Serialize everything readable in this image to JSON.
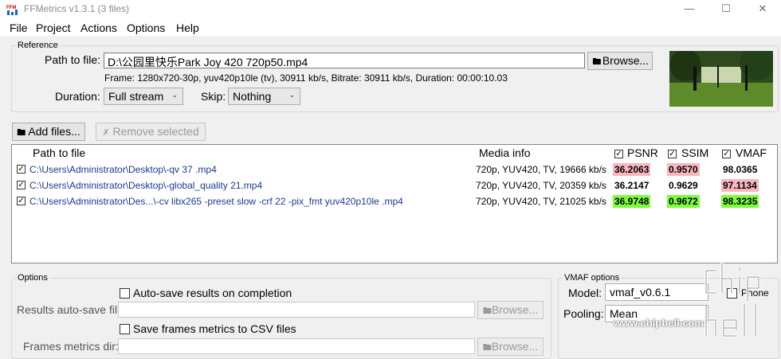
{
  "window": {
    "title": "FFMetrics v1.3.1 (3 files)",
    "controls": [
      "—",
      "☐",
      "✕"
    ]
  },
  "menu": [
    "File",
    "Project",
    "Actions",
    "Options",
    "Help"
  ],
  "reference": {
    "legend": "Reference",
    "path_label": "Path to file:",
    "path_value": "D:\\公园里快乐Park Joy 420 720p50.mp4",
    "browse_label": "Browse...",
    "info": "Frame: 1280x720-30p, yuv420p10le (tv), 30911 kb/s, Bitrate: 30911 kb/s, Duration: 00:00:10.03",
    "duration_label": "Duration:",
    "duration_value": "Full stream",
    "skip_label": "Skip:",
    "skip_value": "Nothing"
  },
  "toolbar": {
    "add_files": "Add files...",
    "remove_selected": "Remove selected"
  },
  "table": {
    "headers": {
      "path": "Path to file",
      "media": "Media info",
      "psnr": "PSNR",
      "ssim": "SSIM",
      "vmaf": "VMAF"
    },
    "rows": [
      {
        "path": "C:\\Users\\Administrator\\Desktop\\-qv 37  .mp4",
        "media": "720p, YUV420, TV, 19666 kb/s",
        "psnr": "36.2063",
        "ssim": "0.9570",
        "vmaf": "98.0365"
      },
      {
        "path": "C:\\Users\\Administrator\\Desktop\\-global_quality  21.mp4",
        "media": "720p, YUV420, TV, 20359 kb/s",
        "psnr": "36.2147",
        "ssim": "0.9629",
        "vmaf": "97.1134"
      },
      {
        "path": "C:\\Users\\Administrator\\Des...\\-cv libx265 -preset slow  -crf 22 -pix_fmt yuv420p10le   .mp4",
        "media": "720p, YUV420, TV, 21025 kb/s",
        "psnr": "36.9748",
        "ssim": "0.9672",
        "vmaf": "98.3235"
      }
    ],
    "colors": {
      "worst": "#f9b6bf",
      "best": "#7cfc3c"
    }
  },
  "options": {
    "legend": "Options",
    "autosave_checkbox": "Auto-save results on completion",
    "autosave_dir_label": "Results auto-save fil",
    "browse_label": "Browse...",
    "frames_csv_checkbox": "Save frames metrics to CSV files",
    "frames_dir_label": "Frames metrics dir:"
  },
  "vmaf_options": {
    "legend": "VMAF options",
    "model_label": "Model:",
    "model_value": "vmaf_v0.6.1",
    "phone_label": "Phone",
    "pooling_label": "Pooling:",
    "pooling_value": "Mean"
  },
  "watermark": {
    "logo_text": "chip hell",
    "url": "www.chiphell.com"
  }
}
